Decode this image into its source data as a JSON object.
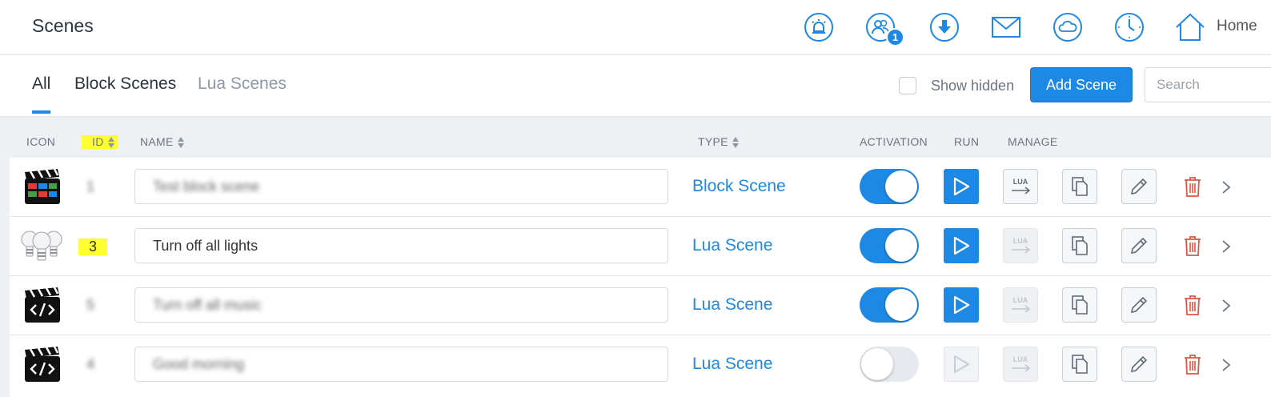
{
  "header": {
    "title": "Scenes",
    "badge_count": "1",
    "home_label": "Home"
  },
  "tabs": [
    {
      "label": "All",
      "active": true
    },
    {
      "label": "Block Scenes",
      "active": false
    },
    {
      "label": "Lua Scenes",
      "active": false
    }
  ],
  "toolbar": {
    "show_hidden_label": "Show hidden",
    "add_button_label": "Add Scene",
    "search_placeholder": "Search"
  },
  "columns": {
    "icon": "ICON",
    "id": "ID",
    "name": "NAME",
    "type": "TYPE",
    "activation": "ACTIVATION",
    "run": "RUN",
    "manage": "MANAGE"
  },
  "rows": [
    {
      "id": "1",
      "name": "Test block scene",
      "type": "Block Scene",
      "icon": "clapperboard-blocks-icon",
      "active": true,
      "lua_enabled": true,
      "blurred": true,
      "highlighted": false
    },
    {
      "id": "3",
      "name": "Turn off all lights",
      "type": "Lua Scene",
      "icon": "light-bulbs-icon",
      "active": true,
      "lua_enabled": false,
      "blurred": false,
      "highlighted": true
    },
    {
      "id": "5",
      "name": "Turn off all music",
      "type": "Lua Scene",
      "icon": "clapperboard-code-icon",
      "active": true,
      "lua_enabled": false,
      "blurred": true,
      "highlighted": false
    },
    {
      "id": "4",
      "name": "Good morning",
      "type": "Lua Scene",
      "icon": "clapperboard-code-icon",
      "active": false,
      "lua_enabled": false,
      "blurred": true,
      "highlighted": false
    }
  ],
  "colors": {
    "accent": "#1e88e5",
    "delete": "#e05545",
    "highlight": "#ffff33",
    "background": "#eef1f4"
  }
}
